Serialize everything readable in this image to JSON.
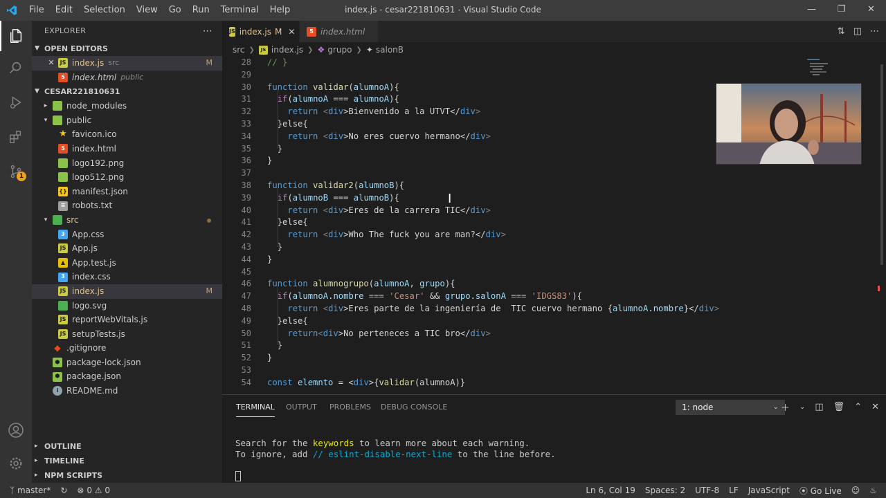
{
  "window": {
    "title": "index.js - cesar221810631 - Visual Studio Code",
    "menus": [
      "File",
      "Edit",
      "Selection",
      "View",
      "Go",
      "Run",
      "Terminal",
      "Help"
    ]
  },
  "activity": {
    "scm_badge": "1"
  },
  "explorer": {
    "header": "EXPLORER",
    "open_editors_label": "OPEN EDITORS",
    "open_editors": [
      {
        "name": "index.js",
        "dir": "src",
        "flag": "M"
      },
      {
        "name": "index.html",
        "dir": "public"
      }
    ],
    "project_label": "CESAR221810631",
    "tree": [
      {
        "name": "node_modules"
      },
      {
        "name": "public"
      },
      {
        "name": "favicon.ico"
      },
      {
        "name": "index.html"
      },
      {
        "name": "logo192.png"
      },
      {
        "name": "logo512.png"
      },
      {
        "name": "manifest.json"
      },
      {
        "name": "robots.txt"
      },
      {
        "name": "src"
      },
      {
        "name": "App.css"
      },
      {
        "name": "App.js"
      },
      {
        "name": "App.test.js"
      },
      {
        "name": "index.css"
      },
      {
        "name": "index.js",
        "flag": "M"
      },
      {
        "name": "logo.svg"
      },
      {
        "name": "reportWebVitals.js"
      },
      {
        "name": "setupTests.js"
      },
      {
        "name": ".gitignore"
      },
      {
        "name": "package-lock.json"
      },
      {
        "name": "package.json"
      },
      {
        "name": "README.md"
      }
    ],
    "bottom_sections": [
      "OUTLINE",
      "TIMELINE",
      "NPM SCRIPTS"
    ]
  },
  "tabs": [
    {
      "label": "index.js",
      "flag": "M"
    },
    {
      "label": "index.html"
    }
  ],
  "breadcrumb": [
    "src",
    "index.js",
    "grupo",
    "salonB"
  ],
  "code": {
    "line_numbers": [
      "28",
      "29",
      "30",
      "31",
      "32",
      "33",
      "34",
      "35",
      "36",
      "37",
      "38",
      "39",
      "40",
      "41",
      "42",
      "43",
      "44",
      "45",
      "46",
      "47",
      "48",
      "49",
      "50",
      "51",
      "52",
      "53",
      "54"
    ],
    "lines": [
      [
        "// }"
      ],
      [
        ""
      ],
      [
        "function",
        " ",
        "validar",
        "(",
        "alumnoA",
        "){"
      ],
      [
        "  ",
        "if",
        "(",
        "alumnoA",
        " === ",
        "alumnoA",
        "){"
      ],
      [
        "    ",
        "return",
        " <",
        "div",
        ">Bienvenido a la UTVT</",
        "div",
        ">"
      ],
      [
        "  ",
        "}else{"
      ],
      [
        "    ",
        "return",
        " <",
        "div",
        ">No eres cuervo hermano</",
        "div",
        ">"
      ],
      [
        "  ",
        "}"
      ],
      [
        "}"
      ],
      [
        ""
      ],
      [
        "function",
        " ",
        "validar2",
        "(",
        "alumnoB",
        "){"
      ],
      [
        "  ",
        "if",
        "(",
        "alumnoB",
        " === ",
        "alumnoB",
        "){"
      ],
      [
        "    ",
        "return",
        " <",
        "div",
        ">Eres de la carrera TIC</",
        "div",
        ">"
      ],
      [
        "  ",
        "}else{"
      ],
      [
        "    ",
        "return",
        " <",
        "div",
        ">Who The fuck you are man?</",
        "div",
        ">"
      ],
      [
        "  ",
        "}"
      ],
      [
        "}"
      ],
      [
        ""
      ],
      [
        "function",
        " ",
        "alumnogrupo",
        "(",
        "alumnoA",
        ", ",
        "grupo",
        "){"
      ],
      [
        "  ",
        "if",
        "(",
        "alumnoA",
        ".",
        "nombre",
        " === ",
        "'Cesar'",
        " && ",
        "grupo",
        ".",
        "salonA",
        " === ",
        "'IDGS83'",
        "){"
      ],
      [
        "    ",
        "return",
        " <",
        "div",
        ">Eres parte de la ingeniería de  TIC cuervo hermano {",
        "alumnoA",
        ".",
        "nombre",
        "}</",
        "div",
        ">"
      ],
      [
        "  ",
        "}else{"
      ],
      [
        "    ",
        "return",
        "<",
        "div",
        ">No perteneces a TIC bro</",
        "div",
        ">"
      ],
      [
        "  ",
        "}"
      ],
      [
        "}"
      ],
      [
        ""
      ],
      [
        "const",
        " ",
        "elemnto",
        " = <",
        "div",
        ">{",
        "validar",
        "(alumnoA)}"
      ]
    ]
  },
  "panel": {
    "tabs": [
      "TERMINAL",
      "OUTPUT",
      "PROBLEMS",
      "DEBUG CONSOLE"
    ],
    "terminal_select": "1: node",
    "line1_a": "Search for the ",
    "line1_b": "keywords",
    "line1_c": " to learn more about each warning.",
    "line2_a": "To ignore, add ",
    "line2_b": "// eslint-disable-next-line",
    "line2_c": " to the line before."
  },
  "status": {
    "branch": "master*",
    "problems": "0",
    "warnings": "0",
    "position": "Ln 6, Col 19",
    "spaces": "Spaces: 2",
    "encoding": "UTF-8",
    "eol": "LF",
    "language": "JavaScript",
    "golive": "Go Live"
  },
  "colors": {
    "accent_blue": "#007acc",
    "modified": "#e2c08d",
    "keyword": "#569cd6",
    "function": "#dcdcaa",
    "string": "#ce9178",
    "variable": "#9cdcfe"
  }
}
